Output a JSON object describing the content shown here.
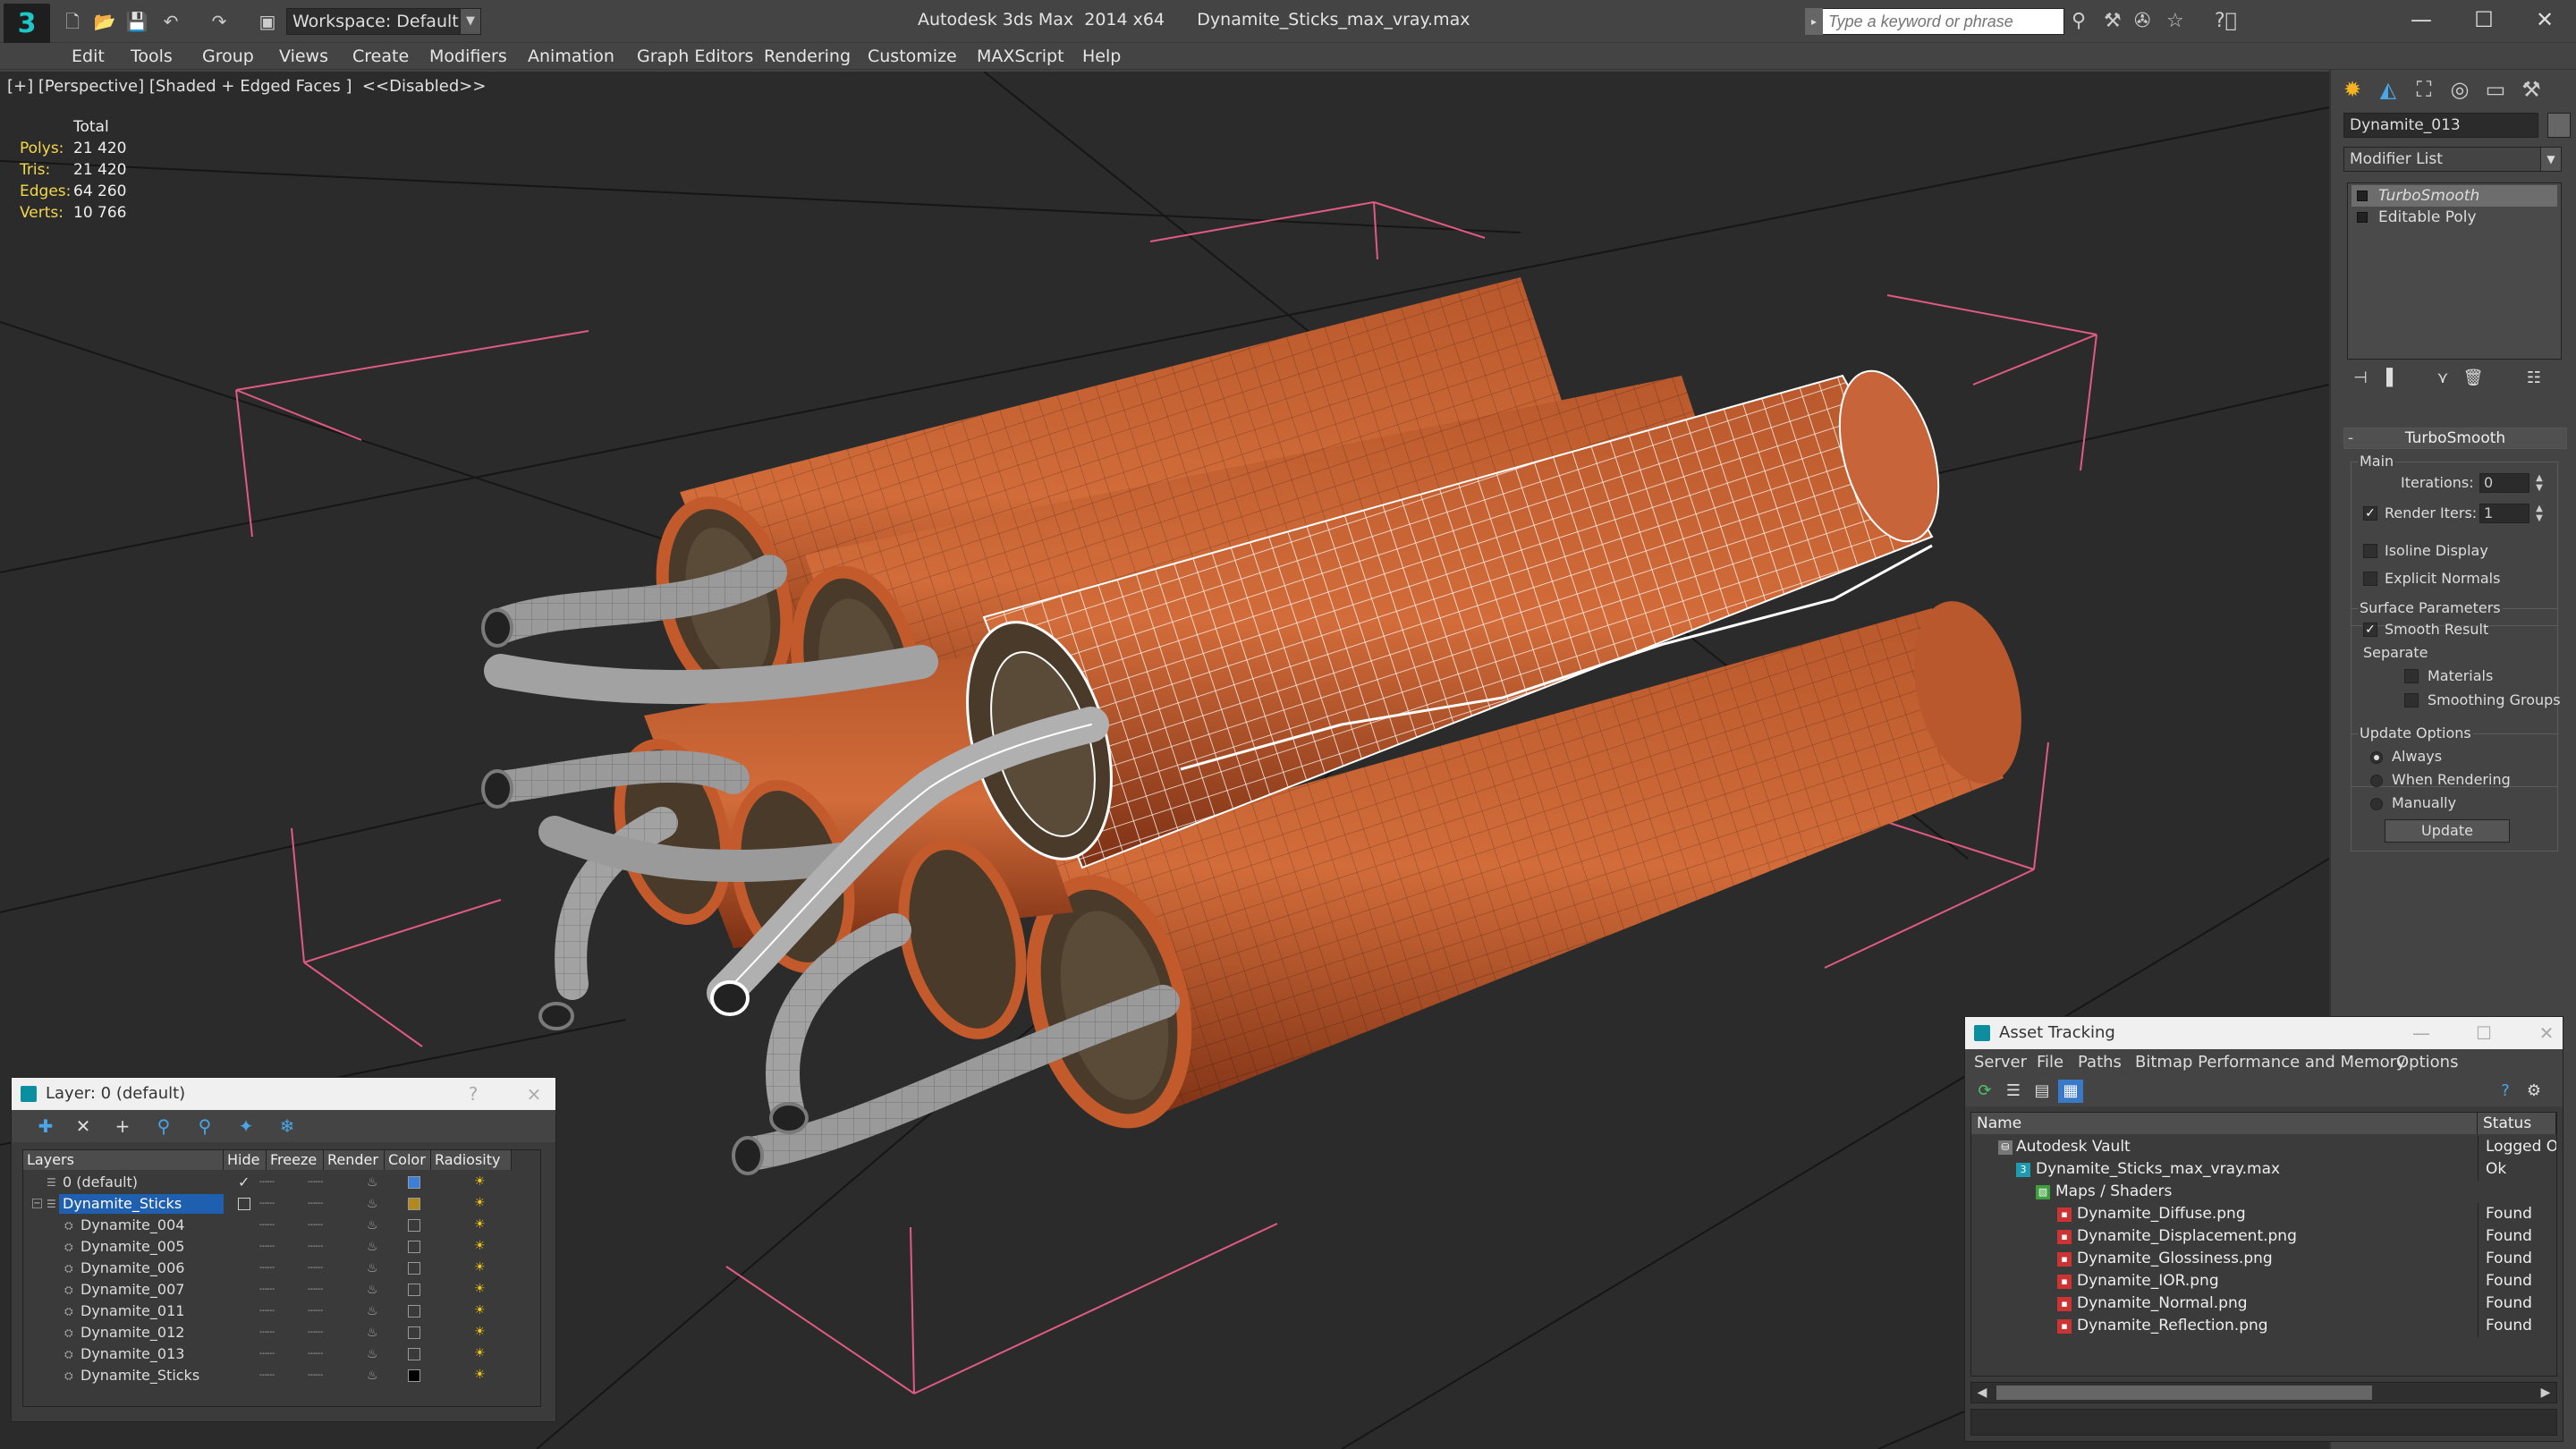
{
  "app": {
    "title": "Autodesk 3ds Max  2014 x64      Dynamite_Sticks_max_vray.max",
    "workspace": "Workspace: Default",
    "search_placeholder": "Type a keyword or phrase"
  },
  "menu": [
    "Edit",
    "Tools",
    "Group",
    "Views",
    "Create",
    "Modifiers",
    "Animation",
    "Graph Editors",
    "Rendering",
    "Customize",
    "MAXScript",
    "Help"
  ],
  "viewport": {
    "label": "[+] [Perspective] [Shaded + Edged Faces ]  <<Disabled>>",
    "stats": {
      "total": "Total",
      "rows": [
        {
          "k": "Polys:",
          "v": "21 420"
        },
        {
          "k": "Tris:",
          "v": "21 420"
        },
        {
          "k": "Edges:",
          "v": "64 260"
        },
        {
          "k": "Verts:",
          "v": "10 766"
        }
      ]
    }
  },
  "command_panel": {
    "object_name": "Dynamite_013",
    "modifier_list": "Modifier List",
    "stack": [
      "TurboSmooth",
      "Editable Poly"
    ],
    "rollout": "TurboSmooth",
    "main_label": "Main",
    "iterations_label": "Iterations:",
    "iterations_value": "0",
    "render_iters_label": "Render Iters:",
    "render_iters_value": "1",
    "isoline": "Isoline Display",
    "explicit_normals": "Explicit Normals",
    "surface_params": "Surface Parameters",
    "smooth_result": "Smooth Result",
    "separate": "Separate",
    "materials": "Materials",
    "smoothing_groups": "Smoothing Groups",
    "update_options": "Update Options",
    "always": "Always",
    "when_rendering": "When Rendering",
    "manually": "Manually",
    "update_button": "Update"
  },
  "layer_dialog": {
    "title": "Layer: 0 (default)",
    "help": "?",
    "close": "×",
    "columns": [
      "Layers",
      "Hide",
      "Freeze",
      "Render",
      "Color",
      "Radiosity"
    ],
    "rows": [
      {
        "name": "0 (default)",
        "color": "#3b7fd9"
      },
      {
        "name": "Dynamite_Sticks",
        "color": "#b08a1c"
      },
      {
        "name": "Dynamite_004",
        "color": "#3a3a3a"
      },
      {
        "name": "Dynamite_005",
        "color": "#3a3a3a"
      },
      {
        "name": "Dynamite_006",
        "color": "#3a3a3a"
      },
      {
        "name": "Dynamite_007",
        "color": "#3a3a3a"
      },
      {
        "name": "Dynamite_011",
        "color": "#3a3a3a"
      },
      {
        "name": "Dynamite_012",
        "color": "#3a3a3a"
      },
      {
        "name": "Dynamite_013",
        "color": "#3a3a3a"
      },
      {
        "name": "Dynamite_Sticks",
        "color": "#000000"
      }
    ]
  },
  "asset_dialog": {
    "title": "Asset Tracking",
    "menu": [
      "Server",
      "File",
      "Paths",
      "Bitmap Performance and Memory",
      "Options"
    ],
    "columns": [
      "Name",
      "Status"
    ],
    "rows": [
      {
        "name": "Autodesk Vault",
        "status": "Logged Out"
      },
      {
        "name": "Dynamite_Sticks_max_vray.max",
        "status": "Ok"
      },
      {
        "name": "Maps / Shaders",
        "status": ""
      },
      {
        "name": "Dynamite_Diffuse.png",
        "status": "Found"
      },
      {
        "name": "Dynamite_Displacement.png",
        "status": "Found"
      },
      {
        "name": "Dynamite_Glossiness.png",
        "status": "Found"
      },
      {
        "name": "Dynamite_IOR.png",
        "status": "Found"
      },
      {
        "name": "Dynamite_Normal.png",
        "status": "Found"
      },
      {
        "name": "Dynamite_Reflection.png",
        "status": "Found"
      }
    ]
  }
}
